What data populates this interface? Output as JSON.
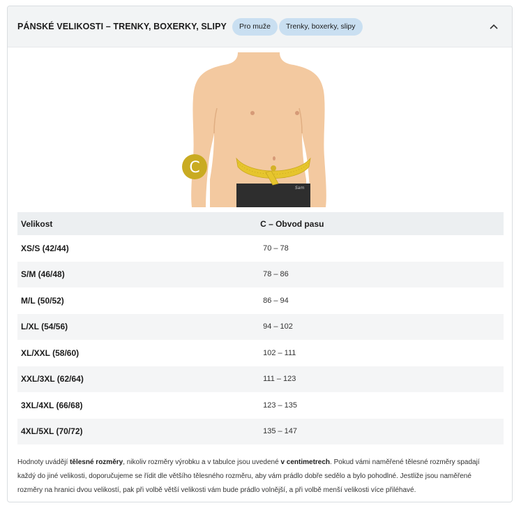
{
  "header": {
    "title": "PÁNSKÉ VELIKOSTI – TRENKY, BOXERKY, SLIPY",
    "tags": [
      "Pro muže",
      "Trenky, boxerky, slipy"
    ]
  },
  "figure": {
    "marker_letter": "C",
    "marker_color": "#c9ab22",
    "skin_color": "#f3c9a0",
    "underwear_color": "#2e2e2e",
    "tape_color": "#e6c52d",
    "brand_text": "Sam"
  },
  "table": {
    "headers": [
      "Velikost",
      "C – Obvod pasu"
    ],
    "rows": [
      {
        "size": "XS/S (42/44)",
        "waist": "70 – 78"
      },
      {
        "size": "S/M (46/48)",
        "waist": "78 – 86"
      },
      {
        "size": "M/L (50/52)",
        "waist": "86 – 94"
      },
      {
        "size": "L/XL (54/56)",
        "waist": "94 – 102"
      },
      {
        "size": "XL/XXL (58/60)",
        "waist": "102 – 111"
      },
      {
        "size": "XXL/3XL (62/64)",
        "waist": "111 – 123"
      },
      {
        "size": "3XL/4XL (66/68)",
        "waist": "123 – 135"
      },
      {
        "size": "4XL/5XL (70/72)",
        "waist": "135 – 147"
      }
    ]
  },
  "note": {
    "part1": "Hodnoty uvádějí ",
    "bold1": "tělesné rozměry",
    "part2": ", nikoliv rozměry výrobku a v tabulce jsou uvedené ",
    "bold2": "v centimetrech",
    "part3": ". Pokud vámi naměřené tělesné rozměry spadají každý do jiné velikosti, doporučujeme se řídit dle většího tělesného rozměru, aby vám prádlo dobře sedělo a bylo pohodlné. Jestliže jsou naměřené rozměry na hranici dvou velikostí, pak při volbě větší velikosti vám bude prádlo volnější, a při volbě menší velikosti více přiléhavé."
  },
  "colors": {
    "header_bg": "#f2f4f5",
    "tag_bg": "#c9dff1",
    "row_alt_bg": "#f4f5f6"
  }
}
